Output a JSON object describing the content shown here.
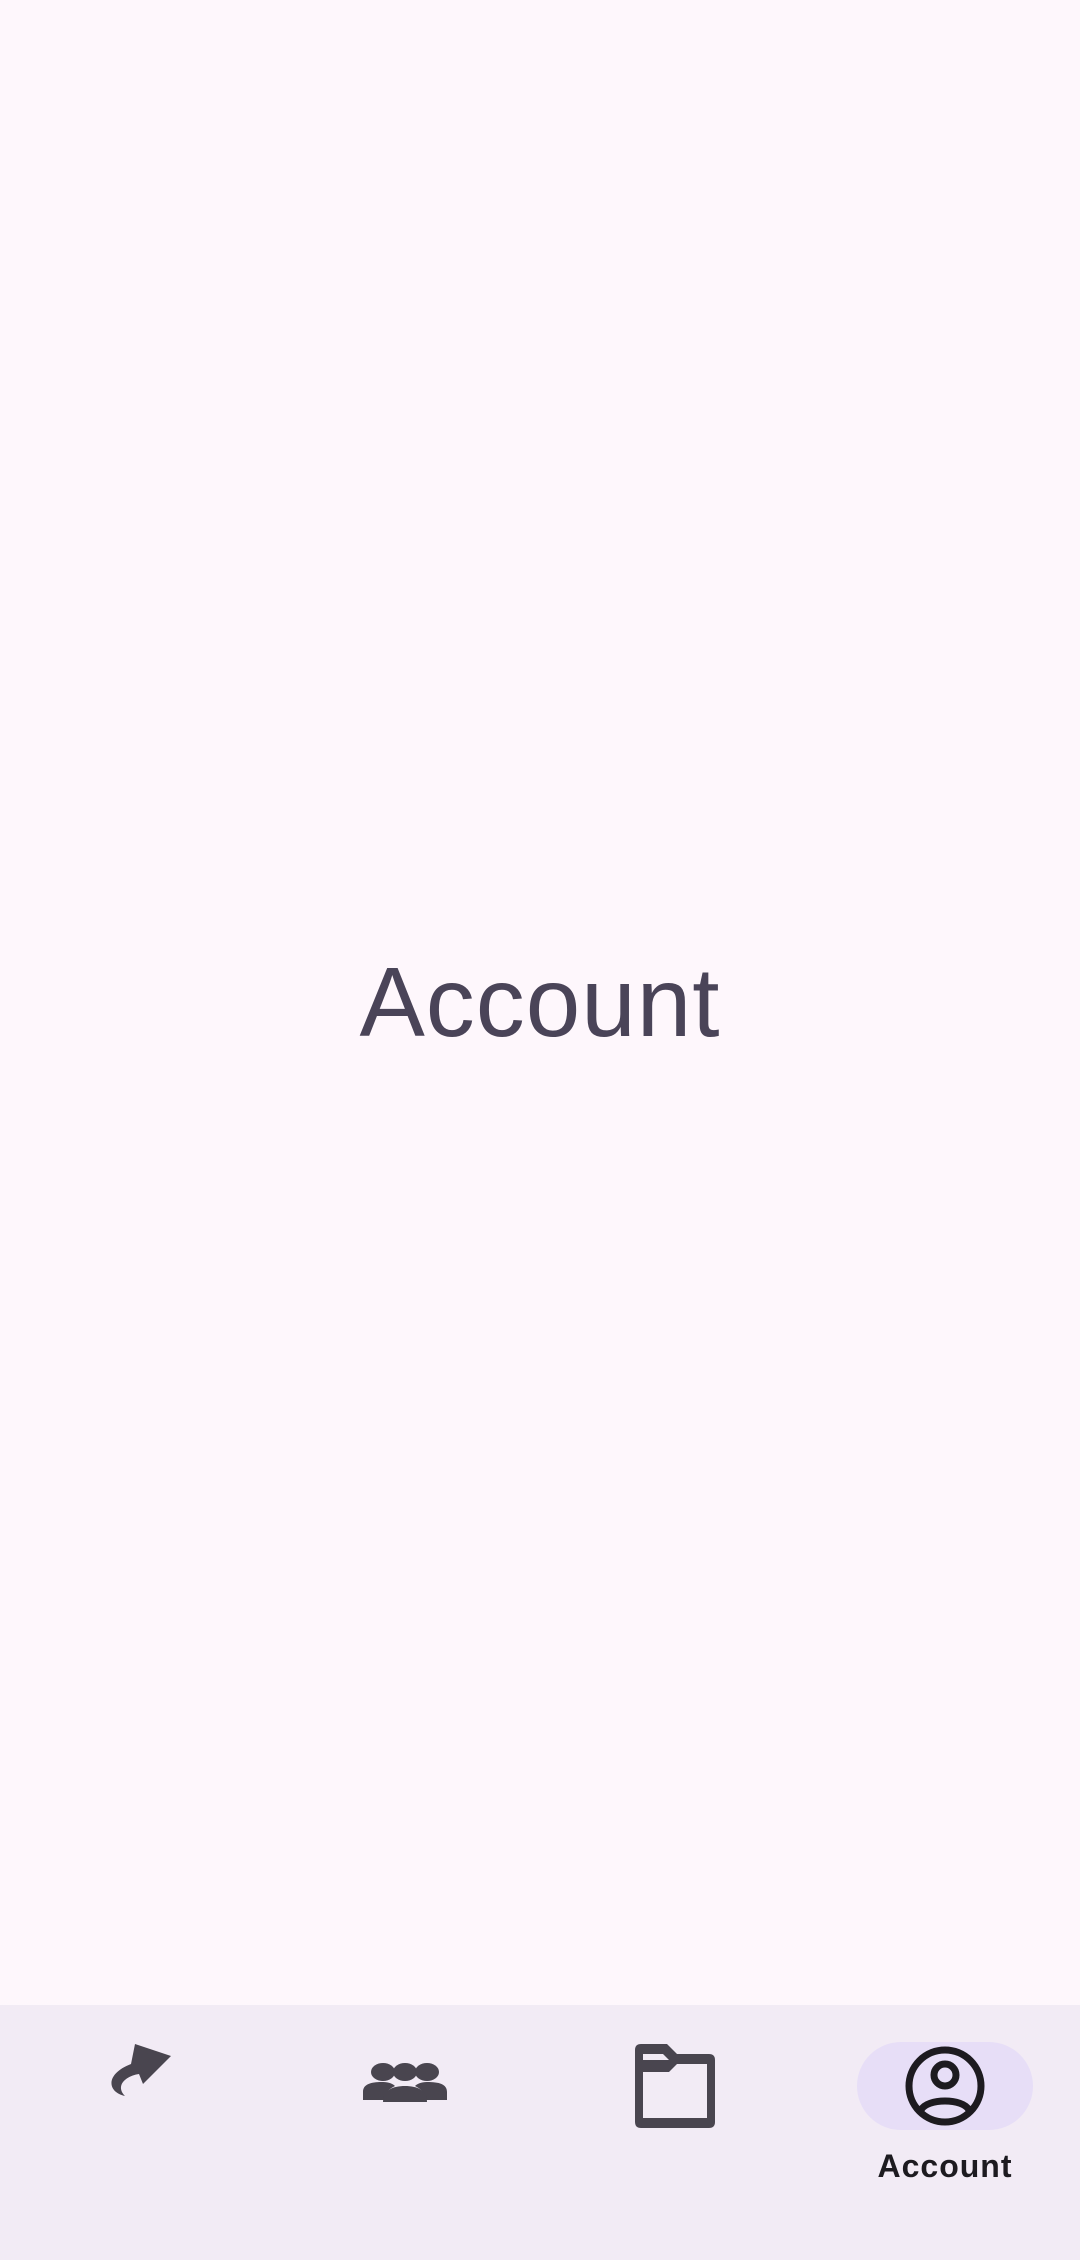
{
  "main": {
    "title": "Account"
  },
  "bottom_nav": {
    "items": [
      {
        "label": "",
        "icon": "share-arrow-icon",
        "active": false
      },
      {
        "label": "",
        "icon": "groups-icon",
        "active": false
      },
      {
        "label": "",
        "icon": "folder-icon",
        "active": false
      },
      {
        "label": "Account",
        "icon": "account-circle-icon",
        "active": true
      }
    ]
  },
  "colors": {
    "background": "#fef7fc",
    "nav_background": "#f2ebf5",
    "indicator": "#e7def7",
    "icon": "#49454f",
    "active_icon": "#1d1b20"
  }
}
